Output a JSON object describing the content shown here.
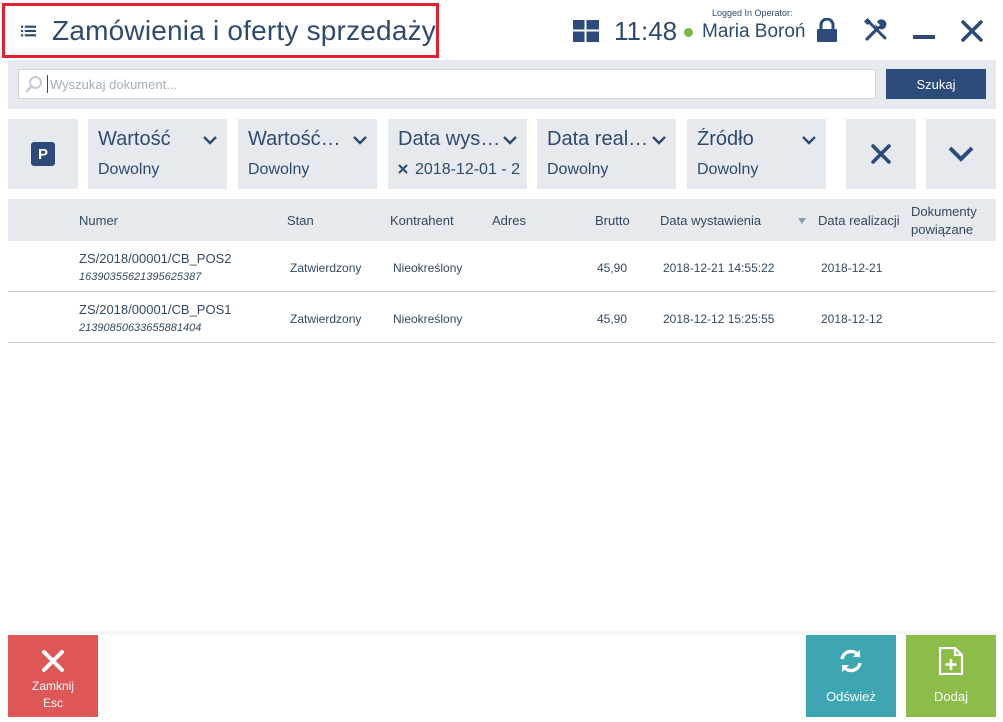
{
  "header": {
    "title": "Zamówienia i oferty sprzedaży",
    "time": "11:48",
    "operator_caption": "Logged In Operator:",
    "operator_name": "Maria Boroń"
  },
  "search": {
    "placeholder": "Wyszukaj dokument...",
    "value": "",
    "button_label": "Szukaj"
  },
  "filters": [
    {
      "label": "Wartość",
      "value": "Dowolny",
      "active": false
    },
    {
      "label": "Wartość…",
      "value": "Dowolny",
      "active": false
    },
    {
      "label": "Data wys…",
      "value": "2018-12-01 - 2",
      "active": true
    },
    {
      "label": "Data real…",
      "value": "Dowolny",
      "active": false
    },
    {
      "label": "Źródło",
      "value": "Dowolny",
      "active": false
    }
  ],
  "table": {
    "columns": {
      "numer": "Numer",
      "stan": "Stan",
      "kontrahent": "Kontrahent",
      "adres": "Adres",
      "brutto": "Brutto",
      "data_wystawienia": "Data wystawienia",
      "data_realizacji": "Data realizacji",
      "dokumenty_line1": "Dokumenty",
      "dokumenty_line2": "powiązane"
    },
    "sorted_column": "data_wystawienia",
    "rows": [
      {
        "numer": "ZS/2018/00001/CB_POS2",
        "kod": "16390355621395625387",
        "stan": "Zatwierdzony",
        "kontrahent": "Nieokreślony",
        "adres": "",
        "brutto": "45,90",
        "data_wystawienia": "2018-12-21 14:55:22",
        "data_realizacji": "2018-12-21",
        "dokumenty": ""
      },
      {
        "numer": "ZS/2018/00001/CB_POS1",
        "kod": "21390850633655881404",
        "stan": "Zatwierdzony",
        "kontrahent": "Nieokreślony",
        "adres": "",
        "brutto": "45,90",
        "data_wystawienia": "2018-12-12 15:25:55",
        "data_realizacji": "2018-12-12",
        "dokumenty": ""
      }
    ]
  },
  "footer": {
    "close_label": "Zamknij",
    "close_shortcut": "Esc",
    "refresh_label": "Odśwież",
    "add_label": "Dodaj"
  },
  "colors": {
    "accent": "#2c4a7a",
    "highlight_border": "#e4202e",
    "close_button": "#de5656",
    "refresh_button": "#3ea6b3",
    "add_button": "#8cbd49",
    "online_dot": "#7ab648"
  }
}
